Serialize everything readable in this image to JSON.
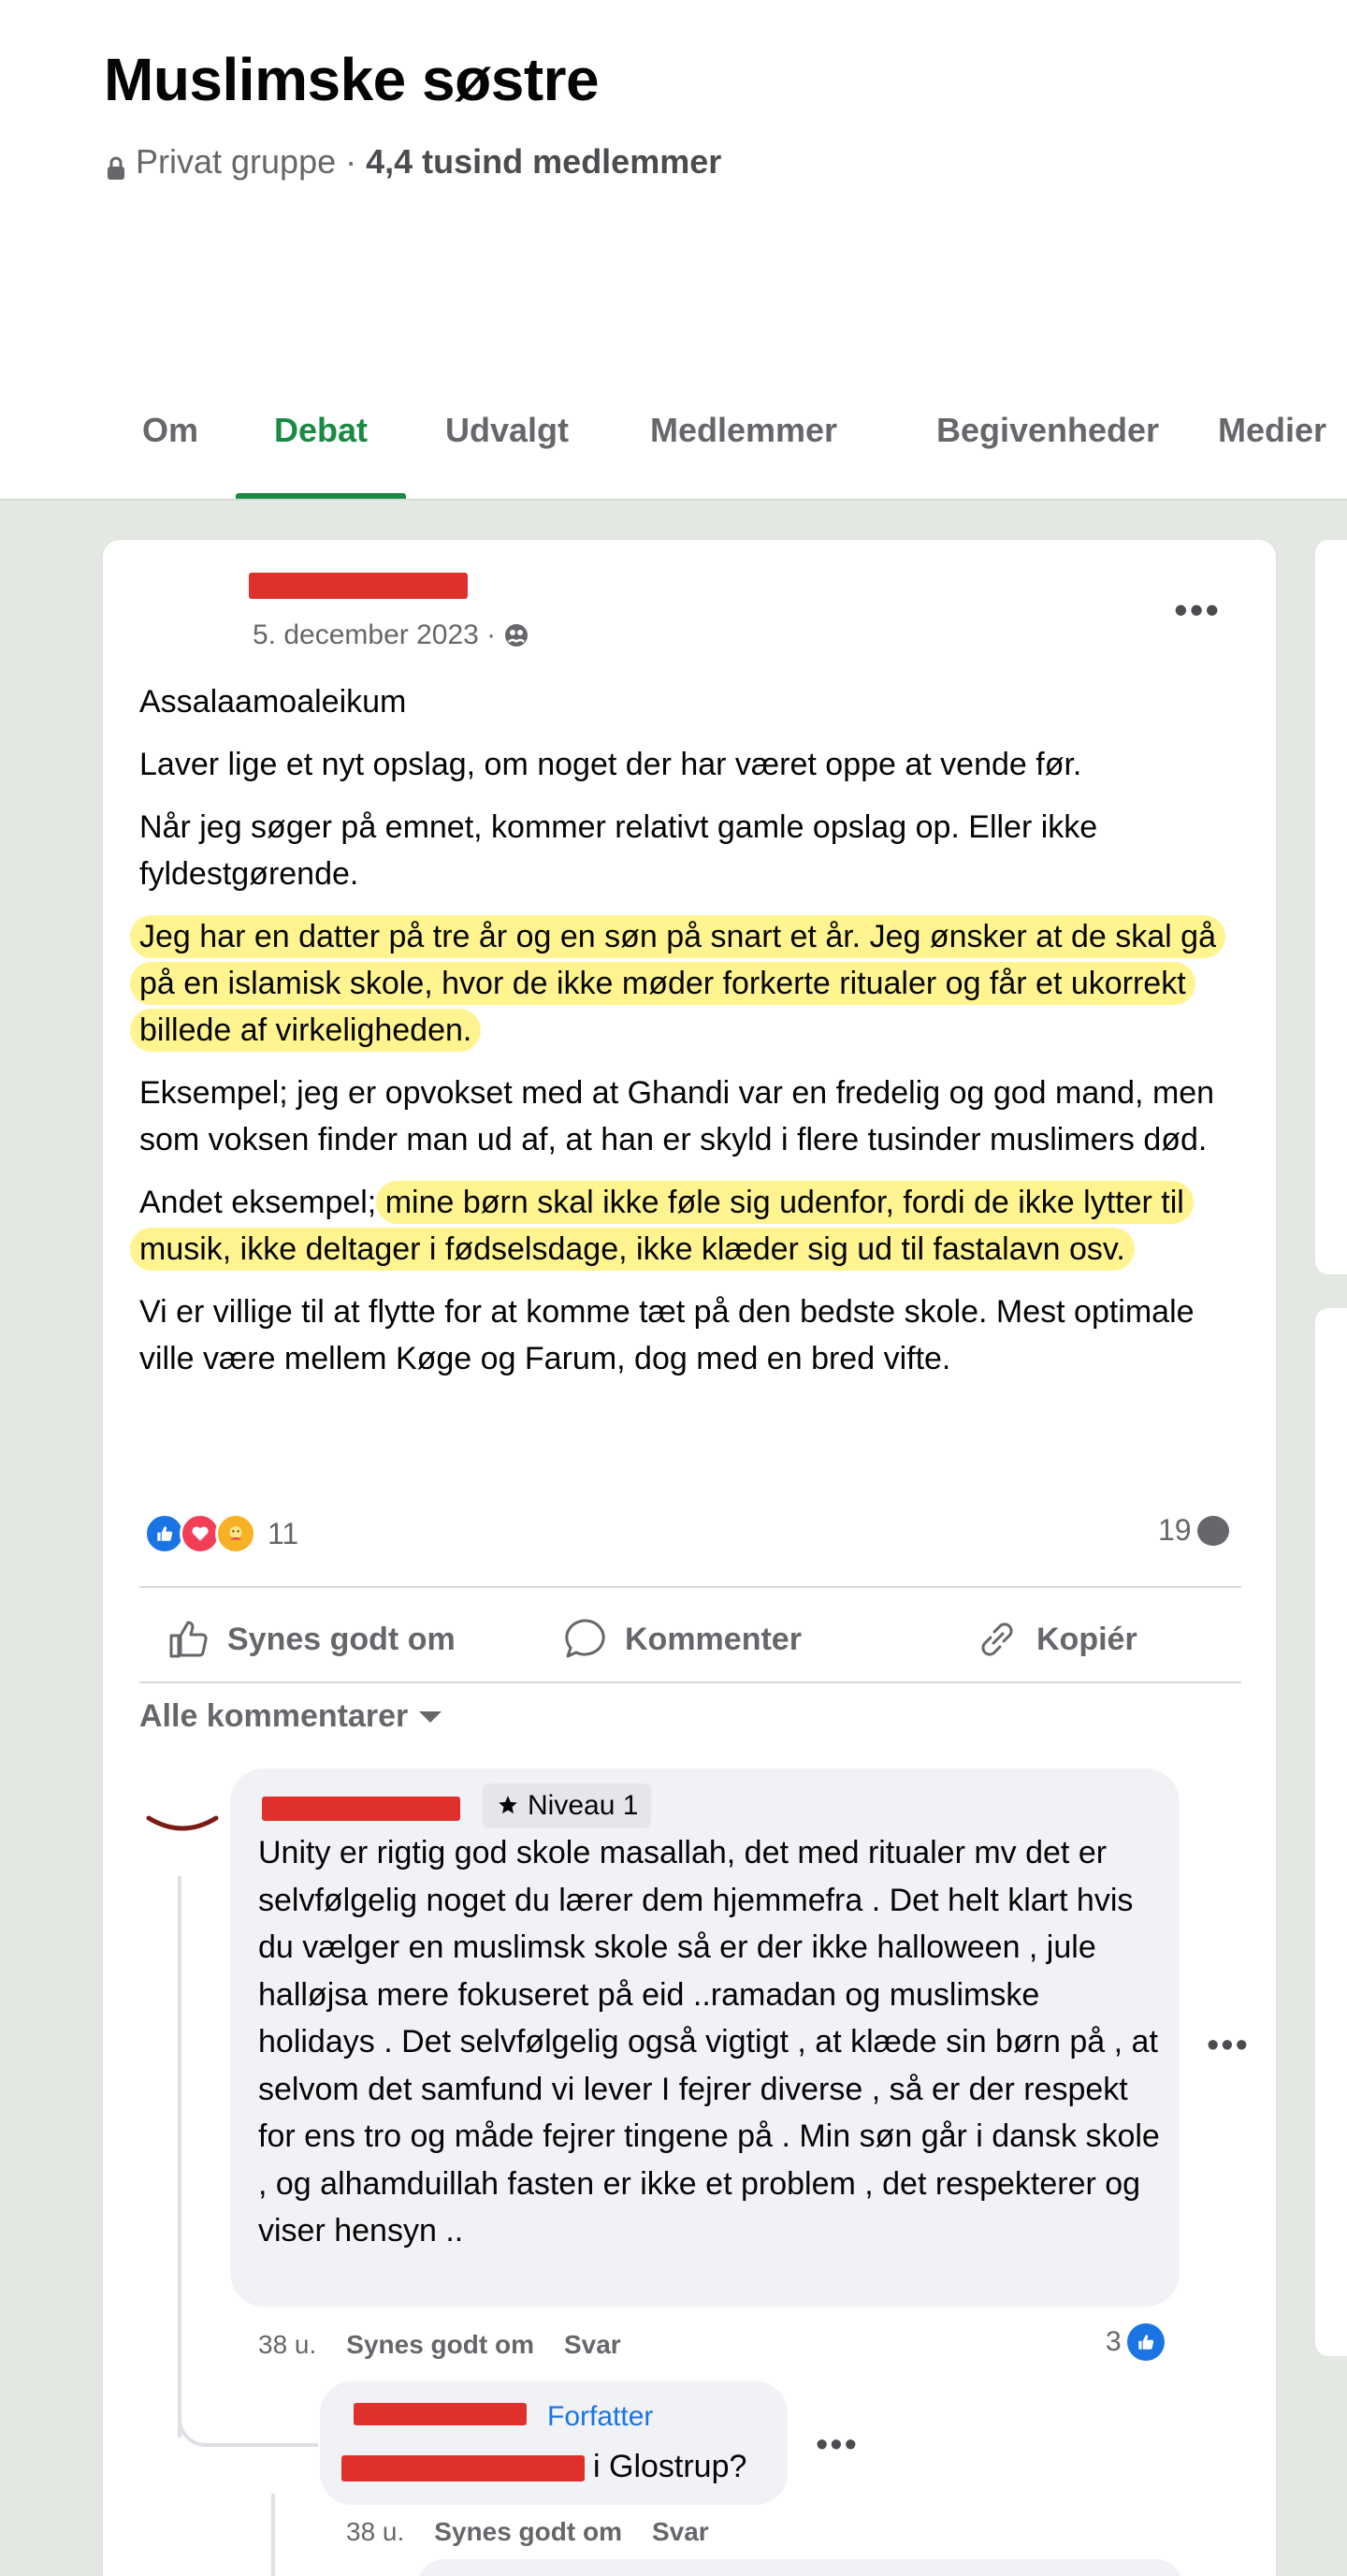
{
  "group": {
    "title": "Muslimske søstre",
    "privacy": "Privat gruppe",
    "separator": "·",
    "members": "4,4 tusind medlemmer"
  },
  "tabs": [
    "Om",
    "Debat",
    "Udvalgt",
    "Medlemmer",
    "Begivenheder",
    "Medier"
  ],
  "active_tab": "Debat",
  "colors": {
    "accent": "#1a8a43",
    "highlight": "#fff064",
    "redaction": "#e0302b",
    "like": "#1b74e4"
  },
  "post": {
    "date": "5. december 2023 ·",
    "paragraphs": [
      "Assalaamoaleikum",
      "Laver lige et nyt opslag, om noget der har været oppe at vende før.",
      "Når jeg søger på emnet, kommer relativt gamle opslag op. Eller ikke fyldestgørende.",
      "Jeg har en datter på tre år og en søn på snart et år. Jeg ønsker at de skal gå på en islamisk skole, hvor de ikke møder forkerte ritualer og får et ukorrekt billede af virkeligheden.",
      "Eksempel; jeg er opvokset med at Ghandi var en fredelig og god mand, men som voksen finder man ud af, at han er skyld i flere tusinder muslimers død.",
      "Andet eksempel;",
      "mine børn skal ikke føle sig udenfor, fordi de ikke lytter til musik, ikke deltager i fødselsdage, ikke klæder sig ud til fastalavn osv.",
      "Vi er villige til at flytte for at komme tæt på den bedste skole. Mest optimale ville være mellem Køge og Farum, dog med en bred vifte."
    ],
    "reaction_count": "11",
    "comment_count": "19",
    "actions": {
      "like": "Synes godt om",
      "comment": "Kommenter",
      "copy": "Kopiér"
    },
    "all_comments": "Alle kommentarer"
  },
  "comment1": {
    "badge": "Niveau 1",
    "text": "Unity er rigtig god skole masallah, det med ritualer mv det er selvfølgelig noget du lærer dem hjemmefra . Det helt klart hvis du vælger en muslimsk skole så er der ikke halloween , jule halløjsa mere fokuseret på eid ..ramadan og muslimske holidays . Det selvfølgelig også vigtigt , at klæde sin børn på , at selvom det samfund vi lever I fejrer diverse , så er der respekt for ens tro og måde fejrer tingene på . Min søn går i dansk skole , og alhamduillah fasten er ikke et problem , det respekterer og viser hensyn ..",
    "time": "38 u.",
    "like": "Synes godt om",
    "reply": "Svar",
    "likes": "3"
  },
  "reply1": {
    "tag": "Forfatter",
    "text": "i Glostrup?",
    "time": "38 u.",
    "like": "Synes godt om",
    "reply": "Svar"
  }
}
